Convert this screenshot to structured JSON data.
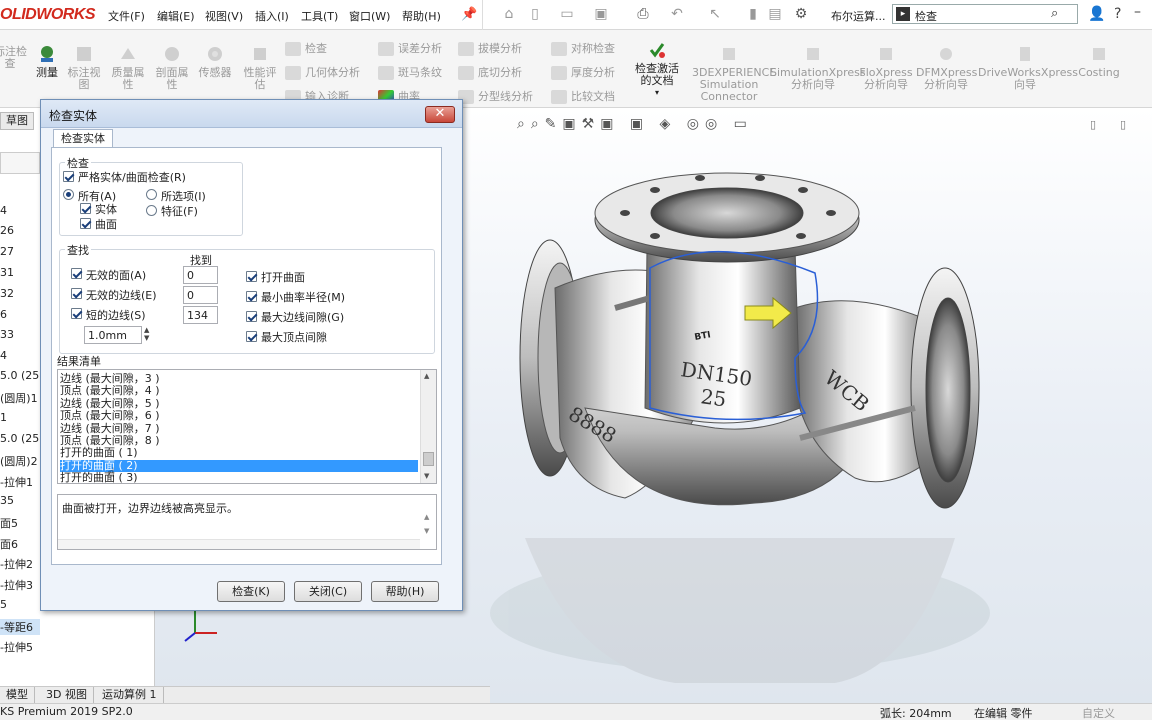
{
  "app": {
    "logo": "OLIDWORKS",
    "version": "KS Premium 2019 SP2.0"
  },
  "menu": [
    "文件(F)",
    "编辑(E)",
    "视图(V)",
    "插入(I)",
    "工具(T)",
    "窗口(W)",
    "帮助(H)"
  ],
  "toolbar": {
    "boolean_label": "布尔运算...",
    "search_text": "检查"
  },
  "commands": {
    "large": [
      {
        "label": "尺寸标注检查",
        "text": "标注检\n查"
      },
      {
        "label": "测量",
        "text": "测量"
      },
      {
        "label": "标注视图",
        "text": "标注视\n图"
      },
      {
        "label": "质量属性",
        "text": "质量属\n性"
      },
      {
        "label": "剖面属性",
        "text": "剖面属\n性"
      },
      {
        "label": "传感器",
        "text": "传感器"
      },
      {
        "label": "性能评估",
        "text": "性能评\n估"
      }
    ],
    "small_col1": [
      "检查",
      "几何体分析",
      "输入诊断"
    ],
    "small_col2": [
      "误差分析",
      "斑马条纹",
      "曲率"
    ],
    "small_col3": [
      "拔模分析",
      "底切分析",
      "分型线分析"
    ],
    "small_col4": [
      "对称检查",
      "厚度分析",
      "比较文档"
    ],
    "check_active": "检查激活\n的文档",
    "addins": [
      "3DEXPERIENCE\nSimulation\nConnector",
      "SimulationXpress\n分析向导",
      "FloXpress\n分析向导",
      "DFMXpress\n分析向导",
      "DriveWorksXpress\n向导",
      "Costing"
    ]
  },
  "left_panel": {
    "sketch_tab": "草图",
    "tree_items": [
      "4",
      "26",
      "27",
      "31",
      "32",
      "6",
      "33",
      "4",
      "5.0 (25)",
      "(圆周)1",
      "1",
      "5.0 (25)",
      "(圆周)2",
      "-拉伸1",
      "35",
      "面5",
      "面6",
      "-拉伸2",
      "-拉伸3",
      "5",
      "-等距6",
      "-拉伸5"
    ]
  },
  "bottom_tabs": [
    "模型",
    "3D 视图",
    "运动算例 1"
  ],
  "status": {
    "length": "弧长: 204mm",
    "mode": "在编辑 零件",
    "custom": "自定义"
  },
  "dialog": {
    "title": "检查实体",
    "tab": "检查实体",
    "check_group": "检查",
    "strict": "严格实体/曲面检查(R)",
    "all": "所有(A)",
    "selected": "所选项(I)",
    "solid": "实体",
    "surface": "曲面",
    "feature": "特征(F)",
    "find_group": "查找",
    "found_header": "找到",
    "invalid_faces": "无效的面(A)",
    "invalid_faces_count": "0",
    "invalid_edges": "无效的边线(E)",
    "invalid_edges_count": "0",
    "short_edges": "短的边线(S)",
    "short_edges_count": "134",
    "short_len": "1.0mm",
    "open_surface": "打开曲面",
    "min_radius": "最小曲率半径(M)",
    "max_edge_gap": "最大边线间隙(G)",
    "max_vertex_gap": "最大顶点间隙",
    "results_title": "结果清单",
    "results": [
      "边线 (最大间隙，3 )",
      "顶点 (最大间隙，4 )",
      "边线 (最大间隙，5 )",
      "顶点 (最大间隙，6 )",
      "边线 (最大间隙，7 )",
      "顶点 (最大间隙，8 )",
      "打开的曲面 ( 1)",
      "打开的曲面 ( 2)",
      "打开的曲面 ( 3)"
    ],
    "selected_result_index": 7,
    "description": "曲面被打开，边界边线被高亮显示。",
    "buttons": {
      "check": "检查(K)",
      "close": "关闭(C)",
      "help": "帮助(H)"
    }
  },
  "model": {
    "mark1": "DN150",
    "mark2": "25",
    "mark3": "WCB",
    "mark4": "8888",
    "brand": "BTI"
  },
  "colors": {
    "accent": "#3399ff",
    "logo": "#d22a1e",
    "highlight": "#2a5fd6"
  }
}
